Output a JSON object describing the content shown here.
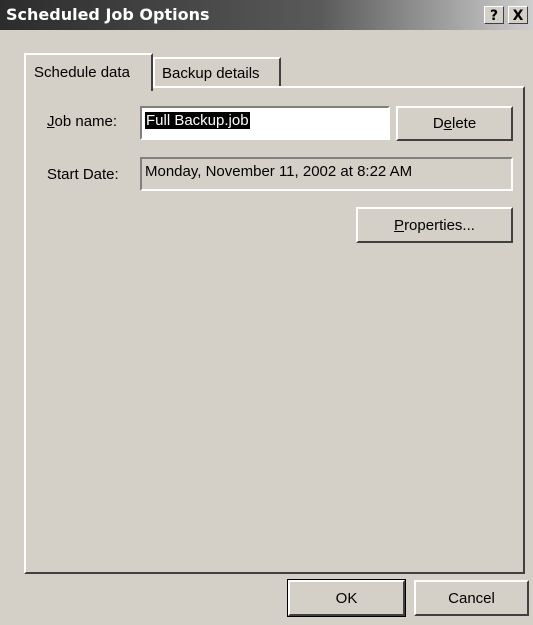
{
  "window": {
    "title": "Scheduled Job Options",
    "help_button": "?",
    "close_button": "X"
  },
  "tabs": [
    {
      "label": "Schedule data",
      "active": true
    },
    {
      "label": "Backup details",
      "active": false
    }
  ],
  "schedule": {
    "job_name_label": "Job name:",
    "job_name_value": "Full Backup.job",
    "start_date_label": "Start Date:",
    "start_date_value": "Monday, November 11, 2002 at 8:22 AM",
    "delete_button": "Delete",
    "properties_button": "Properties..."
  },
  "footer": {
    "ok_button": "OK",
    "cancel_button": "Cancel"
  }
}
